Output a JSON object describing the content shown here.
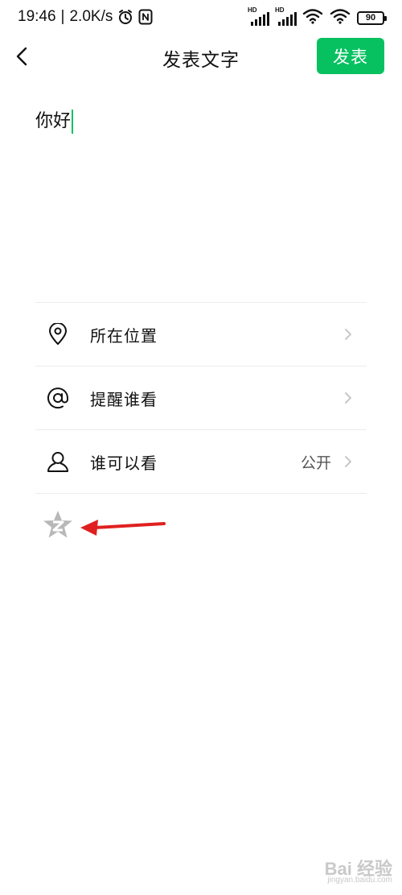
{
  "status_bar": {
    "time": "19:46",
    "separator": "|",
    "network_speed": "2.0K/s",
    "icons": [
      "alarm-icon",
      "nfc-icon",
      "signal-hd-icon",
      "signal-hd-icon",
      "wifi-icon",
      "wifi-icon"
    ],
    "signal_hd_label": "HD",
    "battery": "90"
  },
  "header": {
    "title": "发表文字",
    "publish_label": "发表",
    "back_icon": "chevron-left-icon"
  },
  "compose": {
    "text": "你好"
  },
  "options": [
    {
      "icon": "location-pin-icon",
      "label": "所在位置",
      "value": ""
    },
    {
      "icon": "at-sign-icon",
      "label": "提醒谁看",
      "value": ""
    },
    {
      "icon": "person-icon",
      "label": "谁可以看",
      "value": "公开"
    }
  ],
  "qzone": {
    "icon": "qzone-star-icon"
  },
  "annotation": {
    "icon": "red-arrow-icon",
    "color": "#e02020"
  },
  "watermark": {
    "main": "Bai 经验",
    "sub": "jingyan.baidu.com"
  },
  "colors": {
    "accent": "#07c160",
    "text": "#111111",
    "divider": "#ececec",
    "icon_gray": "#b8b8b8"
  }
}
